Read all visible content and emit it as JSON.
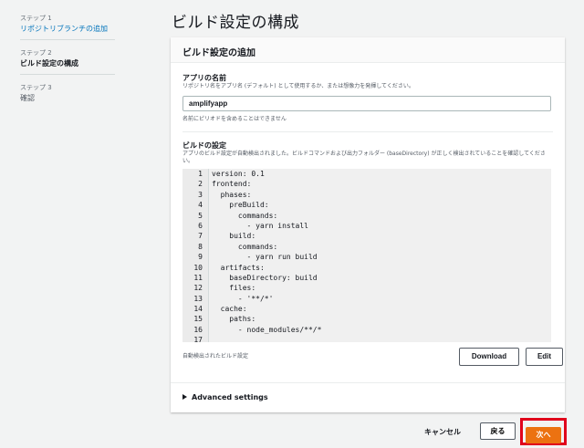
{
  "page_title": "ビルド設定の構成",
  "sidebar": {
    "steps": [
      {
        "label": "ステップ 1",
        "title": "リポジトリブランチの追加"
      },
      {
        "label": "ステップ 2",
        "title": "ビルド設定の構成"
      },
      {
        "label": "ステップ 3",
        "title": "確認"
      }
    ]
  },
  "panel": {
    "header": "ビルド設定の追加",
    "app_name": {
      "label": "アプリの名前",
      "description": "リポジトリ名をアプリ名 (デフォルト) として使用するか、または想像力を発揮してください。",
      "value": "amplifyapp",
      "help": "名前にピリオドを含めることはできません"
    },
    "build_settings": {
      "label": "ビルドの設定",
      "description": "アプリのビルド設定が自動検出されました。ビルドコマンドおよび出力フォルダー (baseDirectory) が正しく検出されていることを確認してください。",
      "line_numbers": [
        "1",
        "2",
        "3",
        "4",
        "5",
        "6",
        "7",
        "8",
        "9",
        "10",
        "11",
        "12",
        "13",
        "14",
        "15",
        "16",
        "17"
      ],
      "code_lines": [
        "version: 0.1",
        "frontend:",
        "  phases:",
        "    preBuild:",
        "      commands:",
        "        - yarn install",
        "    build:",
        "      commands:",
        "        - yarn run build",
        "  artifacts:",
        "    baseDirectory: build",
        "    files:",
        "      - '**/*'",
        "  cache:",
        "    paths:",
        "      - node_modules/**/*",
        ""
      ],
      "caption": "自動検出されたビルド設定",
      "download_label": "Download",
      "edit_label": "Edit"
    },
    "advanced_label": "Advanced settings"
  },
  "actions": {
    "cancel_label": "キャンセル",
    "back_label": "戻る",
    "next_label": "次へ"
  },
  "colors": {
    "link": "#0073bb",
    "primary": "#ec7211",
    "highlight_border": "#e0001b"
  }
}
